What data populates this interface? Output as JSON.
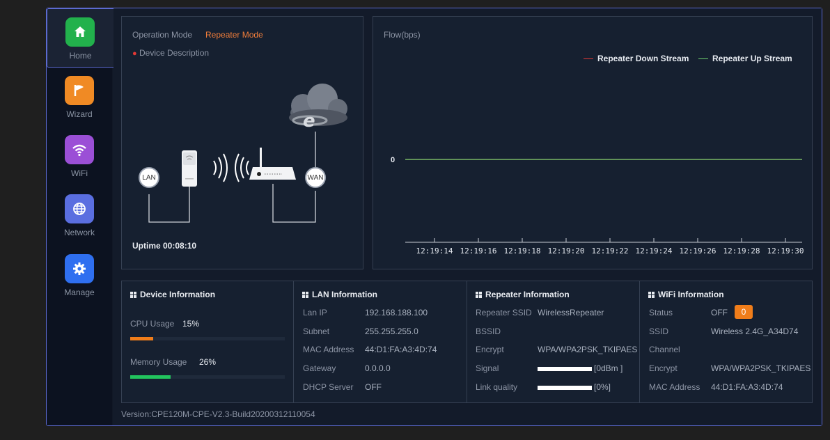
{
  "sidebar": {
    "items": [
      {
        "label": "Home",
        "icon": "home-icon",
        "color": "#22b14c",
        "active": true
      },
      {
        "label": "Wizard",
        "icon": "flag-icon",
        "color": "#f08a24",
        "active": false
      },
      {
        "label": "WiFi",
        "icon": "wifi-icon",
        "color": "#9b4fd6",
        "active": false
      },
      {
        "label": "Network",
        "icon": "globe-icon",
        "color": "#5a6ee0",
        "active": false
      },
      {
        "label": "Manage",
        "icon": "gear-icon",
        "color": "#2f6ff0",
        "active": false
      }
    ]
  },
  "overview": {
    "operation_mode_label": "Operation Mode",
    "operation_mode_value": "Repeater Mode",
    "device_description": "Device Description",
    "lan_label": "LAN",
    "wan_label": "WAN",
    "uptime": "Uptime 00:08:10"
  },
  "flow": {
    "title": "Flow(bps)",
    "legend": [
      {
        "name": "Repeater Down Stream",
        "color": "#e53935"
      },
      {
        "name": "Repeater Up Stream",
        "color": "#6fd36f"
      }
    ]
  },
  "chart_data": {
    "type": "line",
    "title": "Flow(bps)",
    "x": [
      "12:19:14",
      "12:19:16",
      "12:19:18",
      "12:19:20",
      "12:19:22",
      "12:19:24",
      "12:19:26",
      "12:19:28",
      "12:19:30"
    ],
    "yticks": [
      "0"
    ],
    "series": [
      {
        "name": "Repeater Down Stream",
        "color": "#e53935",
        "values": [
          0,
          0,
          0,
          0,
          0,
          0,
          0,
          0,
          0
        ]
      },
      {
        "name": "Repeater Up Stream",
        "color": "#6fd36f",
        "values": [
          0,
          0,
          0,
          0,
          0,
          0,
          0,
          0,
          0
        ]
      }
    ],
    "legend": "top-right",
    "grid": false
  },
  "device_info": {
    "title": "Device Information",
    "cpu_label": "CPU Usage",
    "cpu_value": "15%",
    "cpu_fraction": 0.15,
    "cpu_color": "#f07d1a",
    "mem_label": "Memory Usage",
    "mem_value": "26%",
    "mem_fraction": 0.26,
    "mem_color": "#22c55e"
  },
  "lan_info": {
    "title": "LAN Information",
    "rows": [
      {
        "label": "Lan IP",
        "value": "192.168.188.100"
      },
      {
        "label": "Subnet",
        "value": "255.255.255.0"
      },
      {
        "label": "MAC Address",
        "value": "44:D1:FA:A3:4D:74"
      },
      {
        "label": "Gateway",
        "value": "0.0.0.0"
      },
      {
        "label": "DHCP Server",
        "value": "OFF"
      }
    ]
  },
  "repeater_info": {
    "title": "Repeater Information",
    "ssid_label": "Repeater SSID",
    "ssid_value": "WirelessRepeater",
    "bssid_label": "BSSID",
    "bssid_value": "",
    "encrypt_label": "Encrypt",
    "encrypt_value": "WPA/WPA2PSK_TKIPAES",
    "signal_label": "Signal",
    "signal_value": "[0dBm ]",
    "link_label": "Link quality",
    "link_value": "[0%]"
  },
  "wifi_info": {
    "title": "WiFi Information",
    "status_label": "Status",
    "status_value": "OFF",
    "status_badge": "0",
    "ssid_label": "SSID",
    "ssid_value": "Wireless 2.4G_A34D74",
    "channel_label": "Channel",
    "channel_value": "",
    "encrypt_label": "Encrypt",
    "encrypt_value": "WPA/WPA2PSK_TKIPAES",
    "mac_label": "MAC Address",
    "mac_value": "44:D1:FA:A3:4D:74"
  },
  "footer": {
    "version": "Version:CPE120M-CPE-V2.3-Build20200312110054"
  }
}
